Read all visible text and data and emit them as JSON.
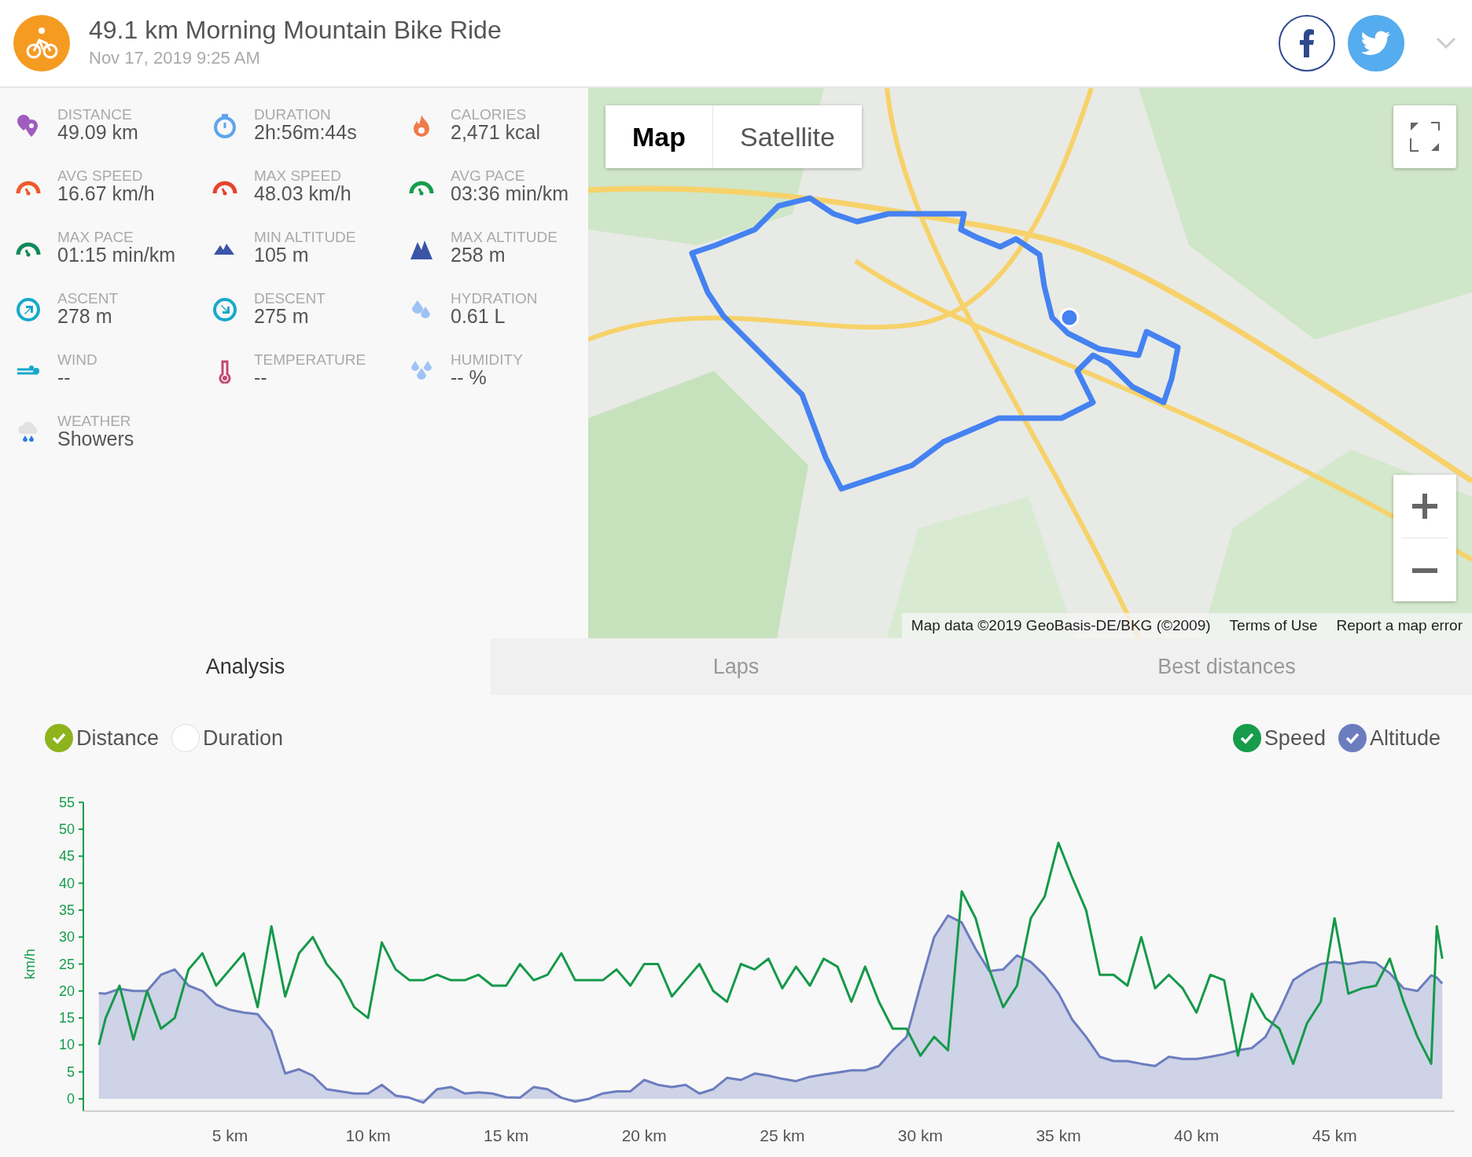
{
  "header": {
    "title": "49.1 km Morning Mountain Bike Ride",
    "date": "Nov 17, 2019 9:25 AM"
  },
  "stats": [
    {
      "label": "DISTANCE",
      "value": "49.09 km"
    },
    {
      "label": "DURATION",
      "value": "2h:56m:44s"
    },
    {
      "label": "CALORIES",
      "value": "2,471 kcal"
    },
    {
      "label": "AVG SPEED",
      "value": "16.67 km/h"
    },
    {
      "label": "MAX SPEED",
      "value": "48.03 km/h"
    },
    {
      "label": "AVG PACE",
      "value": "03:36 min/km"
    },
    {
      "label": "MAX PACE",
      "value": "01:15 min/km"
    },
    {
      "label": "MIN ALTITUDE",
      "value": "105 m"
    },
    {
      "label": "MAX ALTITUDE",
      "value": "258 m"
    },
    {
      "label": "ASCENT",
      "value": "278 m"
    },
    {
      "label": "DESCENT",
      "value": "275 m"
    },
    {
      "label": "HYDRATION",
      "value": "0.61 L"
    },
    {
      "label": "WIND",
      "value": "--"
    },
    {
      "label": "TEMPERATURE",
      "value": "--"
    },
    {
      "label": "HUMIDITY",
      "value": "-- %"
    },
    {
      "label": "WEATHER",
      "value": "Showers"
    }
  ],
  "map": {
    "kind": "picture",
    "map_types": [
      {
        "label": "Map",
        "selected": true
      },
      {
        "label": "Satellite",
        "selected": false
      }
    ],
    "attribution": [
      "Map data ©2019 GeoBasis-DE/BKG (©2009)",
      "Terms of Use",
      "Report a map error"
    ]
  },
  "tabs": [
    {
      "label": "Analysis",
      "selected": true
    },
    {
      "label": "Laps",
      "selected": false
    },
    {
      "label": "Best distances",
      "selected": false
    }
  ],
  "x_axis_options": [
    {
      "label": "Distance",
      "selected": true,
      "color": "#8db31d"
    },
    {
      "label": "Duration",
      "selected": false
    }
  ],
  "series_toggles": [
    {
      "label": "Speed",
      "checked": true,
      "color": "#169c4b"
    },
    {
      "label": "Altitude",
      "checked": true,
      "color": "#6c7dbf"
    }
  ],
  "chart": {
    "chart_data": {
      "type": "line",
      "ylabel": "km/h",
      "xlim": [
        -0.31,
        49.35
      ],
      "ylim": [
        -2.3,
        55
      ],
      "xticks": [
        {
          "value": 5,
          "label": "5 km"
        },
        {
          "value": 10,
          "label": "10 km"
        },
        {
          "value": 15,
          "label": "15 km"
        },
        {
          "value": 20,
          "label": "20 km"
        },
        {
          "value": 25,
          "label": "25 km"
        },
        {
          "value": 30,
          "label": "30 km"
        },
        {
          "value": 35,
          "label": "35 km"
        },
        {
          "value": 40,
          "label": "40 km"
        },
        {
          "value": 45,
          "label": "45 km"
        }
      ],
      "yticks": [
        0,
        5,
        10,
        15,
        20,
        25,
        30,
        35,
        40,
        45,
        50,
        55
      ],
      "x": [
        0.25,
        0.5,
        1,
        1.5,
        2,
        2.5,
        3,
        3.5,
        4,
        4.5,
        5,
        5.5,
        6,
        6.5,
        7,
        7.5,
        8,
        8.5,
        9,
        9.5,
        10,
        10.5,
        11,
        11.5,
        12,
        12.5,
        13,
        13.5,
        14,
        14.5,
        15,
        15.5,
        16,
        16.5,
        17,
        17.5,
        18,
        18.5,
        19,
        19.5,
        20,
        20.5,
        21,
        21.5,
        22,
        22.5,
        23,
        23.5,
        24,
        24.5,
        25,
        25.5,
        26,
        26.5,
        27,
        27.5,
        28,
        28.5,
        29,
        29.5,
        30,
        30.5,
        31,
        31.5,
        32,
        32.5,
        33,
        33.5,
        34,
        34.5,
        35,
        35.5,
        36,
        36.5,
        37,
        37.5,
        38,
        38.5,
        39,
        39.5,
        40,
        40.5,
        41,
        41.5,
        42,
        42.5,
        43,
        43.5,
        44,
        44.5,
        45,
        45.5,
        46,
        46.5,
        47,
        47.5,
        48,
        48.5,
        48.7,
        48.9
      ],
      "series": [
        {
          "type": "area",
          "color": "#6c7dbf",
          "values": [
            19.6,
            19.5,
            20.4,
            20,
            20,
            23,
            24,
            21,
            20,
            17.5,
            16.5,
            16,
            15.7,
            12.6,
            4.7,
            5.5,
            4.3,
            1.8,
            1.4,
            1,
            1,
            2.6,
            0.6,
            0.2,
            -0.7,
            1.8,
            2.2,
            1,
            1.2,
            1,
            0.3,
            0.2,
            2.2,
            1.8,
            0.2,
            -0.5,
            0,
            1,
            1.4,
            1.4,
            3.5,
            2.6,
            2.2,
            2.6,
            1,
            1.8,
            3.9,
            3.5,
            4.7,
            4.3,
            3.7,
            3.3,
            4.1,
            4.5,
            4.9,
            5.3,
            5.3,
            6.1,
            9,
            11.5,
            21,
            30,
            34,
            32.7,
            27.8,
            23.7,
            24,
            26.6,
            25.4,
            22.9,
            19.6,
            14.7,
            11.5,
            7.8,
            7,
            7,
            6.5,
            6.1,
            7.8,
            7.4,
            7.4,
            7.8,
            8.3,
            9,
            9.4,
            11.5,
            16.4,
            22,
            23.7,
            25,
            25.4,
            25,
            25.4,
            25.2,
            23.3,
            20.5,
            20,
            22.9,
            22.5,
            21.4
          ]
        },
        {
          "color": "#16994a",
          "values": [
            10,
            15,
            21,
            11,
            20,
            13,
            15,
            24,
            27,
            21,
            24,
            27,
            17,
            32,
            19,
            27,
            30,
            25,
            22,
            17,
            15,
            29,
            24,
            22,
            22,
            23,
            22,
            22,
            23,
            21,
            21,
            25,
            22,
            23,
            27,
            22,
            22,
            22,
            24,
            21,
            25,
            25,
            19,
            22,
            25,
            20,
            18,
            25,
            24,
            26,
            20.5,
            24.5,
            21,
            26,
            24.5,
            18,
            24.5,
            18,
            13,
            13,
            8,
            11.5,
            9,
            38.5,
            33.5,
            24,
            17,
            21,
            33.5,
            37.5,
            47.5,
            41,
            35,
            23,
            23,
            21,
            30,
            20.5,
            23,
            20.5,
            16,
            23,
            22,
            8,
            19.5,
            15,
            13,
            6.5,
            14,
            18,
            33.5,
            19.5,
            20.5,
            21,
            26,
            18,
            11.5,
            6.5,
            32,
            26
          ]
        }
      ]
    }
  }
}
